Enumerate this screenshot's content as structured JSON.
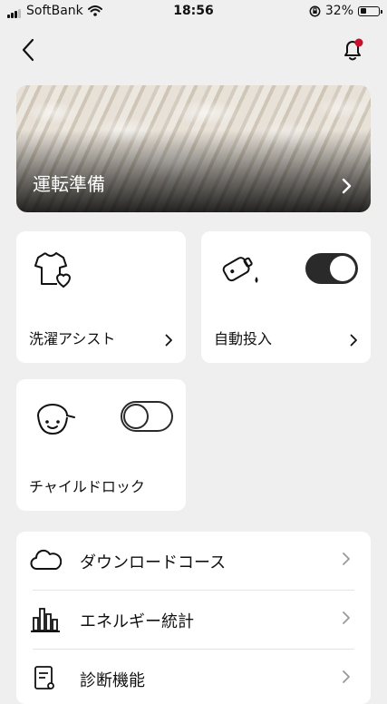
{
  "status_bar": {
    "carrier": "SoftBank",
    "time": "18:56",
    "battery": "32%",
    "battery_level": 0.32
  },
  "hero": {
    "title": "運転準備"
  },
  "cards": {
    "wash_assist": {
      "label": "洗濯アシスト"
    },
    "auto_dose": {
      "label": "自動投入",
      "toggle_on": true
    },
    "child_lock": {
      "label": "チャイルドロック",
      "toggle_on": false
    }
  },
  "menu": {
    "items": [
      {
        "label": "ダウンロードコース",
        "icon": "cloud-icon"
      },
      {
        "label": "エネルギー統計",
        "icon": "bar-chart-icon"
      },
      {
        "label": "診断機能",
        "icon": "diagnosis-icon"
      }
    ]
  },
  "colors": {
    "background": "#efefef",
    "notification_dot": "#c8102e",
    "toggle_dark": "#2a2a2a"
  }
}
